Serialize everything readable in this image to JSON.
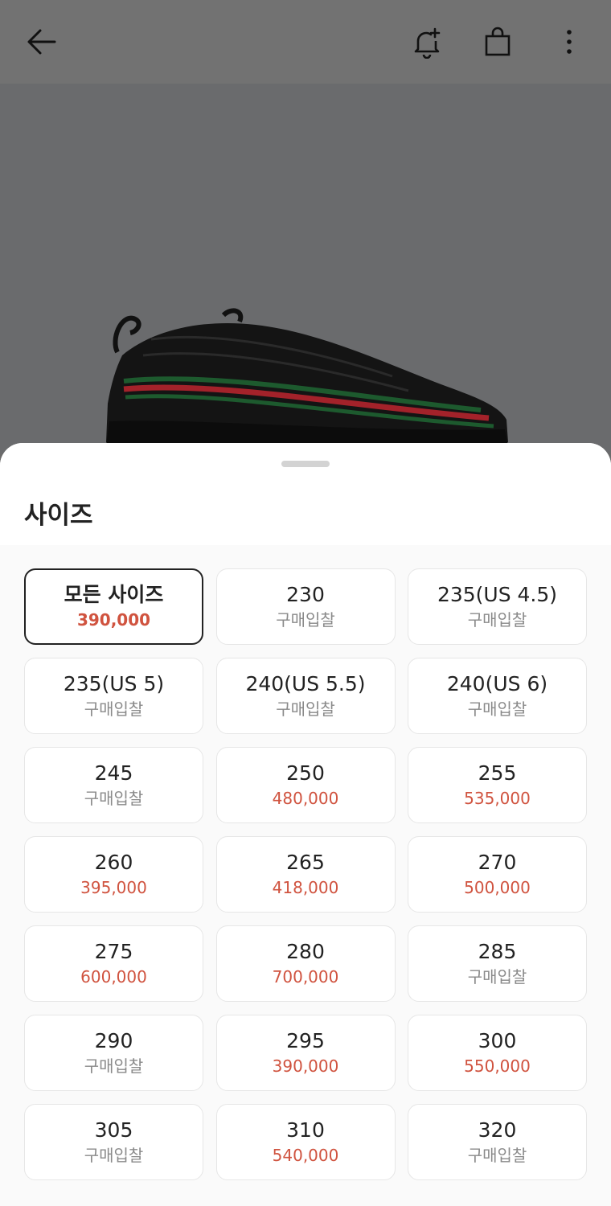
{
  "sheet": {
    "title": "사이즈"
  },
  "sizes": [
    {
      "label": "모든 사이즈",
      "sub": "390,000",
      "kind": "price",
      "selected": true
    },
    {
      "label": "230",
      "sub": "구매입찰",
      "kind": "bid"
    },
    {
      "label": "235(US 4.5)",
      "sub": "구매입찰",
      "kind": "bid"
    },
    {
      "label": "235(US 5)",
      "sub": "구매입찰",
      "kind": "bid"
    },
    {
      "label": "240(US 5.5)",
      "sub": "구매입찰",
      "kind": "bid"
    },
    {
      "label": "240(US 6)",
      "sub": "구매입찰",
      "kind": "bid"
    },
    {
      "label": "245",
      "sub": "구매입찰",
      "kind": "bid"
    },
    {
      "label": "250",
      "sub": "480,000",
      "kind": "price"
    },
    {
      "label": "255",
      "sub": "535,000",
      "kind": "price"
    },
    {
      "label": "260",
      "sub": "395,000",
      "kind": "price"
    },
    {
      "label": "265",
      "sub": "418,000",
      "kind": "price"
    },
    {
      "label": "270",
      "sub": "500,000",
      "kind": "price"
    },
    {
      "label": "275",
      "sub": "600,000",
      "kind": "price"
    },
    {
      "label": "280",
      "sub": "700,000",
      "kind": "price"
    },
    {
      "label": "285",
      "sub": "구매입찰",
      "kind": "bid"
    },
    {
      "label": "290",
      "sub": "구매입찰",
      "kind": "bid"
    },
    {
      "label": "295",
      "sub": "390,000",
      "kind": "price"
    },
    {
      "label": "300",
      "sub": "550,000",
      "kind": "price"
    },
    {
      "label": "305",
      "sub": "구매입찰",
      "kind": "bid"
    },
    {
      "label": "310",
      "sub": "540,000",
      "kind": "price"
    },
    {
      "label": "320",
      "sub": "구매입찰",
      "kind": "bid"
    }
  ],
  "colors": {
    "price": "#d0533f",
    "bid": "#8a8a8a",
    "selected_border": "#222222"
  },
  "icons": {
    "back": "arrow-left-icon",
    "alert": "bell-plus-icon",
    "cart": "shopping-bag-icon",
    "more": "more-vertical-icon"
  }
}
